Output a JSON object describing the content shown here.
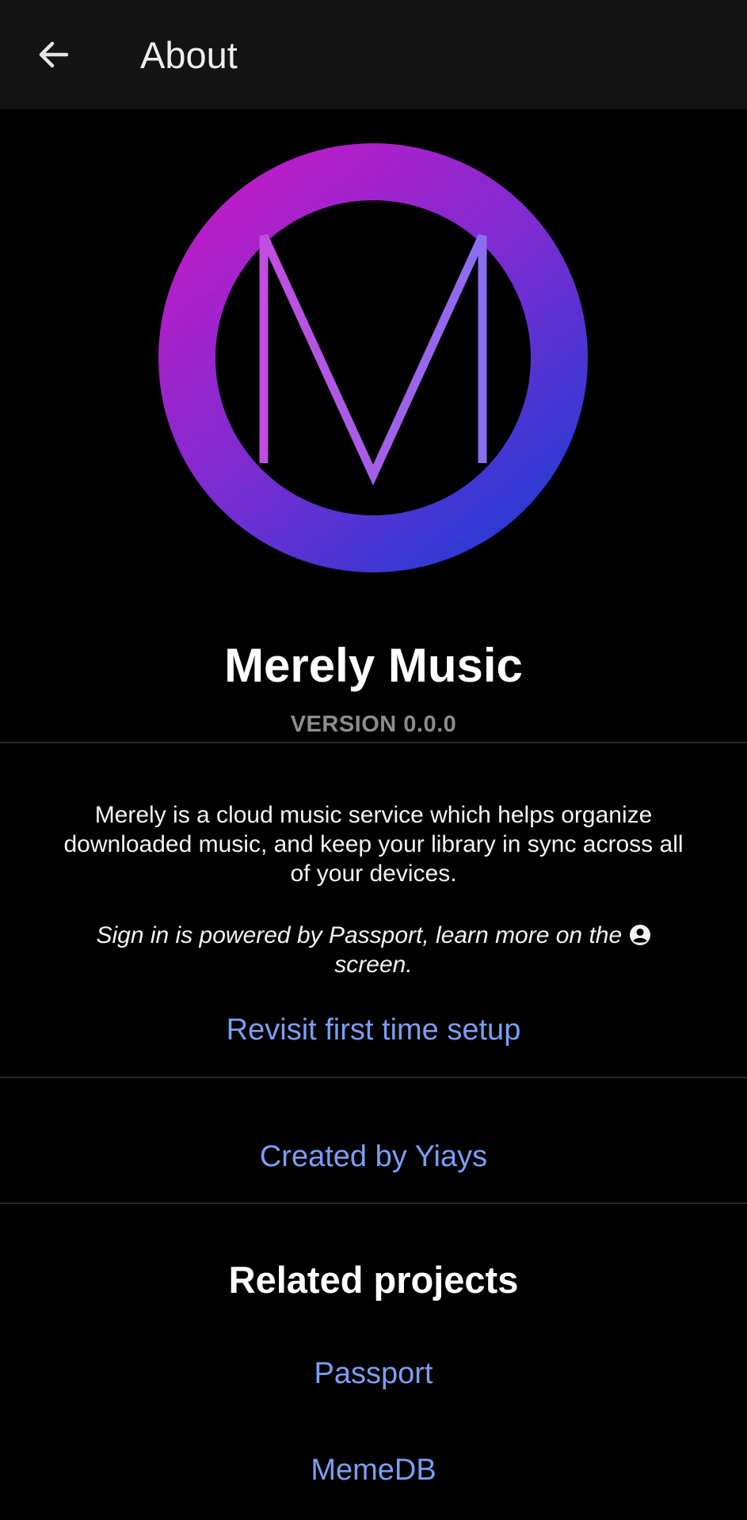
{
  "appbar": {
    "title": "About",
    "back_icon": "arrow-left-icon"
  },
  "logo": {
    "icon": "merely-music-logo",
    "colors": {
      "ring_start": "#b51fc9",
      "ring_mid": "#7a2cd1",
      "ring_end": "#2f3ad4",
      "letter_left": "#c14ee0",
      "letter_right": "#8a6ef0"
    }
  },
  "app": {
    "name": "Merely Music",
    "version": "VERSION 0.0.0"
  },
  "about": {
    "description": "Merely is a cloud music service which helps organize downloaded music, and keep your library in sync across all of your devices.",
    "signin_prefix": "Sign in is powered by Passport, learn more on the",
    "signin_icon": "account-circle-icon",
    "signin_suffix": "screen.",
    "setup_link": "Revisit first time setup"
  },
  "credits": {
    "created_by": "Created by Yiays"
  },
  "related": {
    "title": "Related projects",
    "items": [
      {
        "label": "Passport"
      },
      {
        "label": "MemeDB"
      }
    ]
  },
  "colors": {
    "background": "#000000",
    "appbar": "#141414",
    "link": "#7b9ef4",
    "muted": "#8d8d8d",
    "divider": "#2a2a2a"
  }
}
